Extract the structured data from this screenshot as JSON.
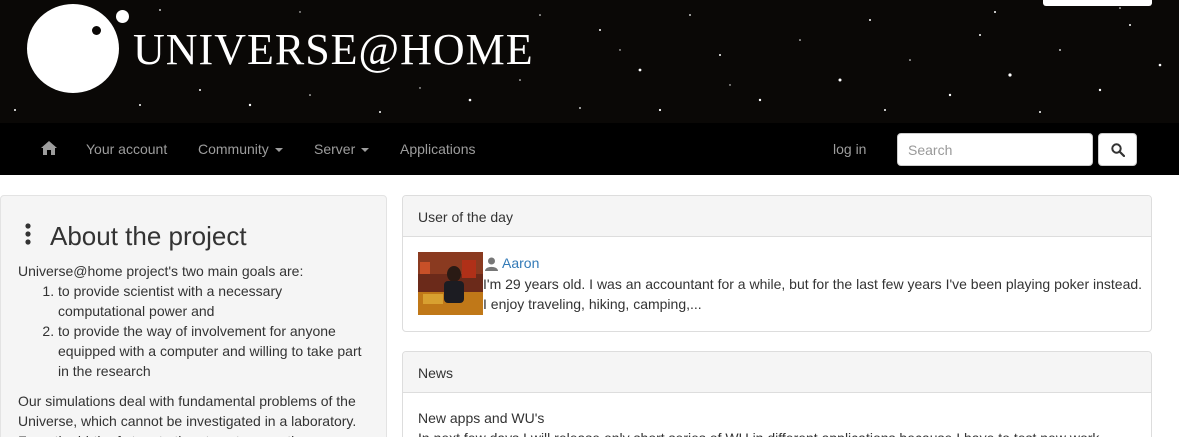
{
  "header": {
    "site_name": "UNIVERSE@HOME",
    "colors": {
      "banner_bg": "#0a0806",
      "navbar_bg": "#000000",
      "link": "#337ab7"
    }
  },
  "navbar": {
    "home_icon": "home-icon",
    "items": [
      {
        "label": "Your account",
        "dropdown": false
      },
      {
        "label": "Community",
        "dropdown": true
      },
      {
        "label": "Server",
        "dropdown": true
      },
      {
        "label": "Applications",
        "dropdown": false
      }
    ],
    "login_label": "log in",
    "search": {
      "placeholder": "Search",
      "value": "",
      "button_icon": "search-icon"
    }
  },
  "about": {
    "icon": "vertical-ellipsis-icon",
    "title": "About the project",
    "intro": "Universe@home project's two main goals are:",
    "goals": [
      "to provide scientist with a necessary computational power and",
      "to provide the way of involvement for anyone equipped with a computer and willing to take part in the research"
    ],
    "paragraph": "Our simulations deal with fundamental problems of the Universe, which cannot be investigated in a laboratory. From the birth of stars to the utmost energetic"
  },
  "user_of_the_day": {
    "heading": "User of the day",
    "user_icon": "user-icon",
    "name": "Aaron",
    "text": "I'm 29 years old. I was an accountant for a while, but for the last few years I've been playing poker instead. I enjoy traveling, hiking, camping,..."
  },
  "news": {
    "heading": "News",
    "item_title": "New apps and WU's",
    "item_text": "In next few days I will release only short series of WU in different applications because I have to test new work"
  }
}
